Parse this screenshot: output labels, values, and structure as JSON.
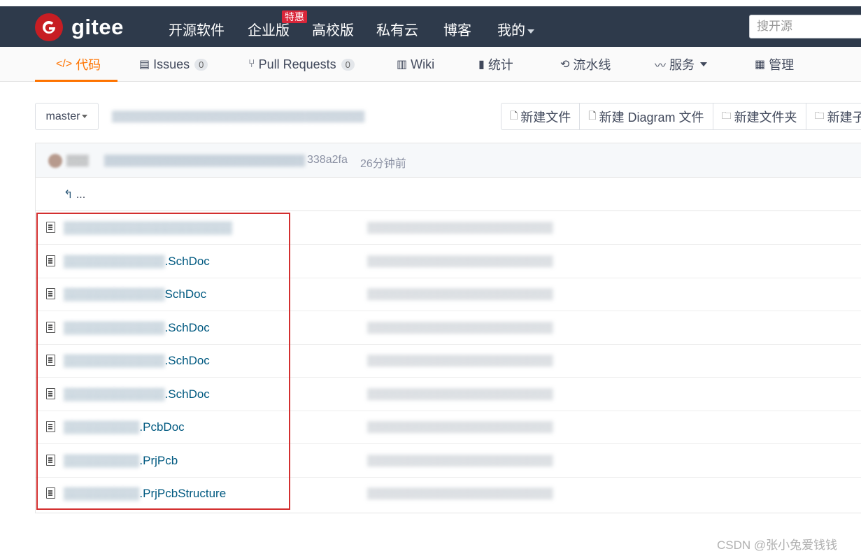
{
  "app": {
    "logo_text": "gitee",
    "nav": [
      "开源软件",
      "企业版",
      "高校版",
      "私有云",
      "博客",
      "我的"
    ],
    "promo_badge": "特惠",
    "search_placeholder": "搜开源"
  },
  "tabs": [
    {
      "label": "代码",
      "icon": "code-icon"
    },
    {
      "label": "Issues",
      "count": "0",
      "icon": "issues-icon"
    },
    {
      "label": "Pull Requests",
      "count": "0",
      "icon": "pull-request-icon"
    },
    {
      "label": "Wiki",
      "icon": "wiki-icon"
    },
    {
      "label": "统计",
      "icon": "stats-icon"
    },
    {
      "label": "流水线",
      "icon": "pipeline-icon"
    },
    {
      "label": "服务",
      "icon": "service-icon"
    },
    {
      "label": "管理",
      "icon": "manage-icon"
    }
  ],
  "toolbar": {
    "branch": "master",
    "actions": [
      "新建文件",
      "新建 Diagram 文件",
      "新建文件夹",
      "新建子模块"
    ]
  },
  "commit": {
    "hash": "338a2fa",
    "time": "26分钟前"
  },
  "up_label": "...",
  "files": [
    {
      "suffix": ""
    },
    {
      "suffix": ".SchDoc"
    },
    {
      "suffix": "SchDoc"
    },
    {
      "suffix": ".SchDoc"
    },
    {
      "suffix": ".SchDoc"
    },
    {
      "suffix": ".SchDoc"
    },
    {
      "suffix": ".PcbDoc"
    },
    {
      "suffix": ".PrjPcb"
    },
    {
      "suffix": ".PrjPcbStructure"
    }
  ],
  "watermark": "CSDN @张小兔爱钱钱",
  "colors": {
    "header_bg": "#2e3a4b",
    "accent_orange": "#fe7300",
    "logo_red": "#c71d23",
    "highlight_red": "#d32f2f",
    "link_blue": "#005980"
  }
}
